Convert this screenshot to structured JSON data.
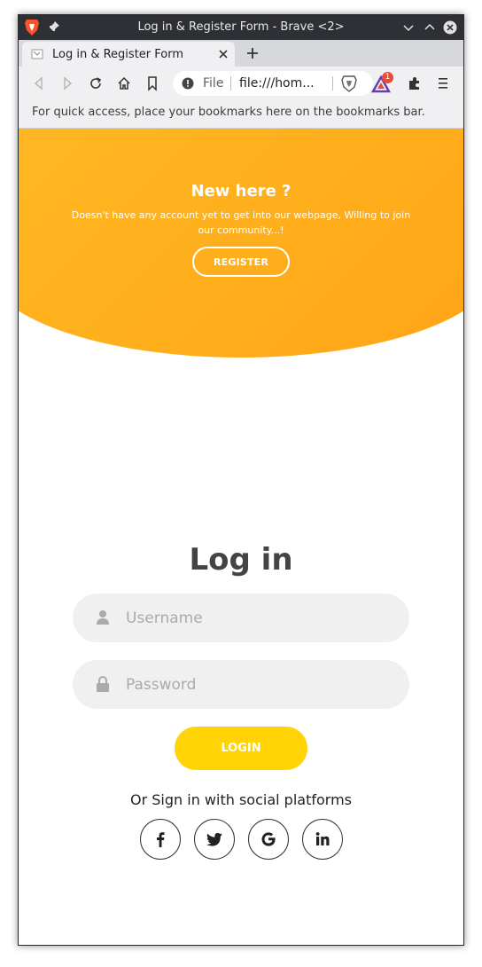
{
  "window": {
    "title": "Log in & Register Form - Brave <2>"
  },
  "tab": {
    "title": "Log in & Register Form"
  },
  "urlbar": {
    "scheme": "File",
    "url": "file:///hom..."
  },
  "rewards": {
    "badge": "1"
  },
  "bookmarks": {
    "hint": "For quick access, place your bookmarks here on the bookmarks bar."
  },
  "hero": {
    "title": "New here ?",
    "text": "Doesn't have any account yet to get into our webpage, Willing to join our community...!",
    "register_label": "REGISTER"
  },
  "login": {
    "title": "Log in",
    "username_placeholder": "Username",
    "password_placeholder": "Password",
    "button_label": "LOGIN",
    "social_text": "Or Sign in with social platforms"
  },
  "colors": {
    "accent": "#ffb520",
    "login_button": "#ffd304",
    "heading": "#444444"
  }
}
